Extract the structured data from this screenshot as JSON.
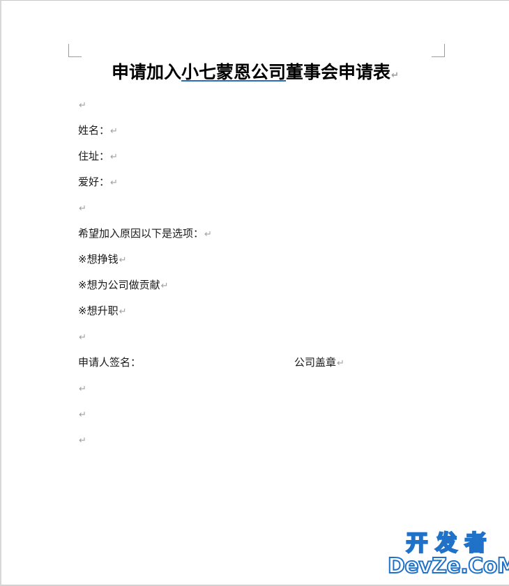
{
  "document": {
    "title_parts": {
      "prefix": "申请加入",
      "underlined": "小七蒙恩公司",
      "suffix": "董事会申请表"
    },
    "title_full": "申请加入小七蒙恩公司董事会申请表",
    "underline_color": "#2b6cb8",
    "pilcrow_glyph": "↵",
    "pilcrow_color": "#a0a0a0",
    "bullet_glyph": "※",
    "paragraphs": [
      {
        "id": "blank-1",
        "text": "",
        "type": "empty"
      },
      {
        "id": "name-field",
        "text": "姓名：",
        "type": "field"
      },
      {
        "id": "address-field",
        "text": "住址：",
        "type": "field"
      },
      {
        "id": "hobby-field",
        "text": "爱好：",
        "type": "field"
      },
      {
        "id": "blank-2",
        "text": "",
        "type": "empty"
      },
      {
        "id": "reason-heading",
        "text": "希望加入原因以下是选项：",
        "type": "heading"
      },
      {
        "id": "option-1",
        "text": "※想挣钱",
        "type": "option"
      },
      {
        "id": "option-2",
        "text": "※想为公司做贡献",
        "type": "option"
      },
      {
        "id": "option-3",
        "text": "※想升职",
        "type": "option"
      },
      {
        "id": "blank-3",
        "text": "",
        "type": "empty"
      }
    ],
    "signature_row": {
      "left_label": "申请人签名：",
      "right_label": "公司盖章"
    },
    "trailing_blanks": [
      {
        "id": "blank-4",
        "text": ""
      },
      {
        "id": "blank-5",
        "text": ""
      },
      {
        "id": "blank-6",
        "text": ""
      }
    ]
  },
  "watermark": {
    "chinese": "开发者",
    "latin": "DevZe.CoM",
    "color": "#1f72c8"
  }
}
